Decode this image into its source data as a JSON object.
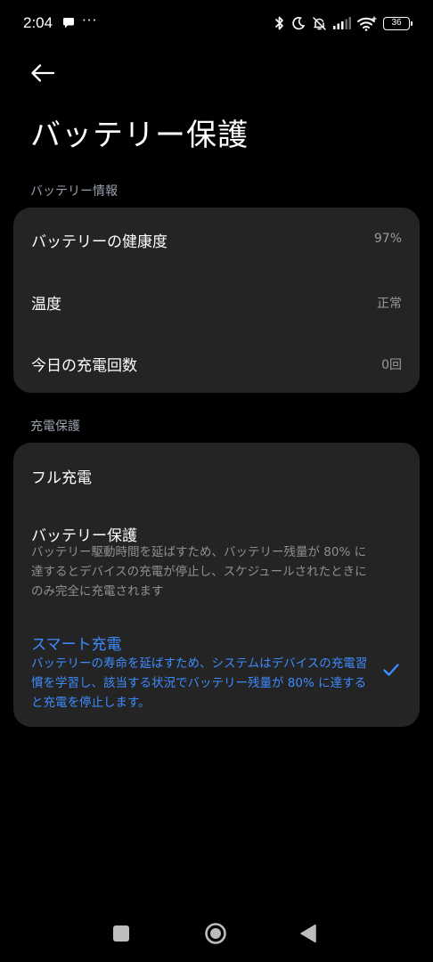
{
  "status_bar": {
    "time": "2:04",
    "more": "···",
    "battery_level": "36",
    "icons": [
      "chat-bubble-icon",
      "bluetooth-icon",
      "moon-icon",
      "bell-off-icon",
      "signal-icon",
      "wifi-icon",
      "battery-icon"
    ]
  },
  "header": {
    "title": "バッテリー保護",
    "back_icon": "arrow-left-icon"
  },
  "battery_info": {
    "section_label": "バッテリー情報",
    "rows": [
      {
        "label": "バッテリーの健康度",
        "value": "97%"
      },
      {
        "label": "温度",
        "value": "正常"
      },
      {
        "label": "今日の充電回数",
        "value": "0回"
      }
    ]
  },
  "charge_protection": {
    "section_label": "充電保護",
    "options": [
      {
        "title": "フル充電",
        "description": "",
        "selected": false
      },
      {
        "title": "バッテリー保護",
        "description": "バッテリー駆動時間を延ばすため、バッテリー残量が 80% に達するとデバイスの充電が停止し、スケジュールされたときにのみ完全に充電されます",
        "selected": false
      },
      {
        "title": "スマート充電",
        "description": "バッテリーの寿命を延ばすため、システムはデバイスの充電習慣を学習し、該当する状況でバッテリー残量が 80% に達すると充電を停止します。",
        "selected": true
      }
    ]
  },
  "nav_bar": {
    "icons": [
      "recent-apps-icon",
      "home-icon",
      "back-triangle-icon"
    ]
  },
  "colors": {
    "background": "#000000",
    "card": "#242424",
    "accent": "#3d8bff",
    "section_label": "#9aa0ad",
    "secondary_text": "#8f8f8f"
  }
}
